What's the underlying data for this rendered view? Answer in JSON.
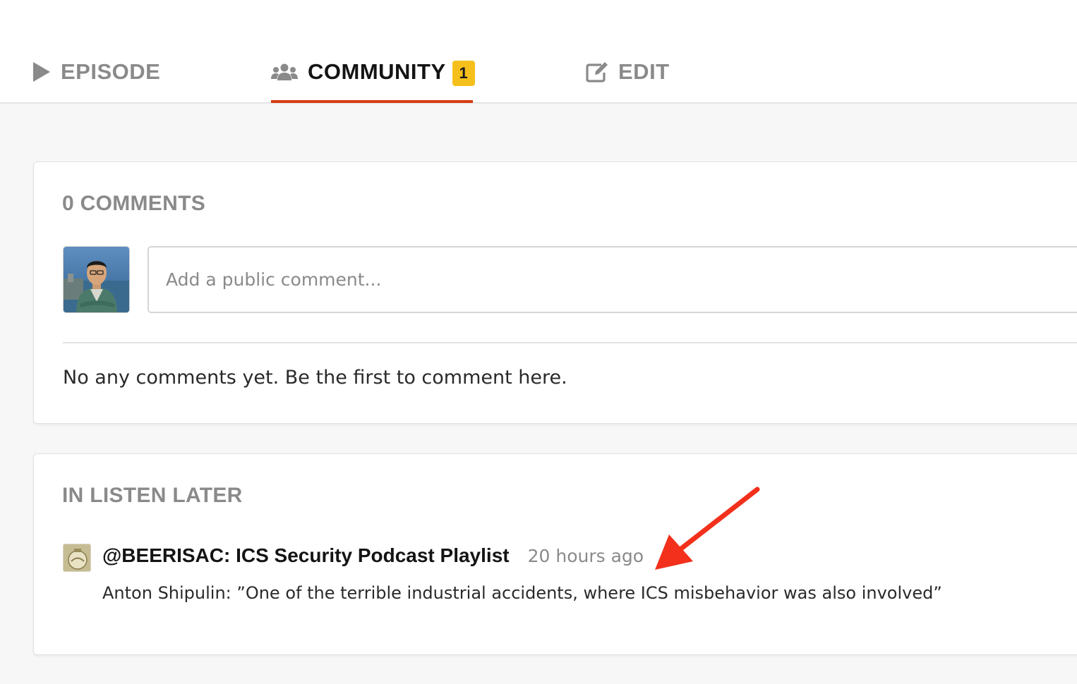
{
  "tabs": {
    "episode": {
      "label": "EPISODE",
      "icon": "play-icon"
    },
    "community": {
      "label": "COMMUNITY",
      "icon": "users-icon",
      "badge": "1",
      "active": true
    },
    "edit": {
      "label": "EDIT",
      "icon": "edit-icon"
    }
  },
  "comments": {
    "title": "0 COMMENTS",
    "input_placeholder": "Add a public comment...",
    "empty_message": "No any comments yet. Be the first to comment here."
  },
  "listen_later": {
    "title": "IN LISTEN LATER",
    "items": [
      {
        "title": "@BEERISAC: ICS Security Podcast Playlist",
        "time": "20 hours ago",
        "description": "Anton Shipulin: ”One of the terrible industrial accidents, where ICS misbehavior was also involved”"
      }
    ]
  },
  "colors": {
    "accent": "#d63c13",
    "badge": "#f6c01c",
    "annotation_arrow": "#f2301b",
    "muted_text": "#8a8a8a"
  }
}
